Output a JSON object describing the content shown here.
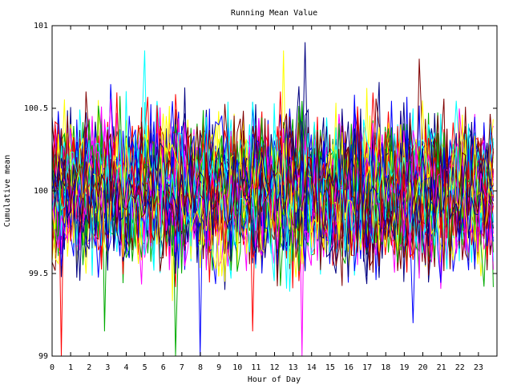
{
  "chart_data": {
    "type": "line",
    "title": "Running Mean Value",
    "xlabel": "Hour of Day",
    "ylabel": "Cumulative mean",
    "xlim": [
      0,
      24
    ],
    "ylim": [
      99,
      101
    ],
    "x_ticks": [
      0,
      1,
      2,
      3,
      4,
      5,
      6,
      7,
      8,
      9,
      10,
      11,
      12,
      13,
      14,
      15,
      16,
      17,
      18,
      19,
      20,
      21,
      22,
      23
    ],
    "x_tick_labels": [
      "0",
      "1",
      "2",
      "3",
      "4",
      "5",
      "6",
      "7",
      "8",
      "9",
      "10",
      "11",
      "12",
      "13",
      "14",
      "15",
      "16",
      "17",
      "18",
      "19",
      "20",
      "21",
      "22",
      "23"
    ],
    "y_ticks": [
      99,
      99.5,
      100,
      100.5,
      101
    ],
    "y_tick_labels": [
      "99",
      "99.5",
      "100",
      "100.5",
      "101"
    ],
    "grid": false,
    "series_colors": [
      "#ff0000",
      "#00aa00",
      "#0000ff",
      "#ff00ff",
      "#00ffff",
      "#ffff00",
      "#000080",
      "#800000"
    ],
    "series_count": 48,
    "points_per_series": 144,
    "series_mean": 100,
    "series_spread": 0.22,
    "notable_spikes": [
      {
        "x": 0.5,
        "y": 99.0
      },
      {
        "x": 6.7,
        "y": 99.0
      },
      {
        "x": 8.0,
        "y": 99.0
      },
      {
        "x": 13.5,
        "y": 99.0
      },
      {
        "x": 5.0,
        "y": 100.85
      },
      {
        "x": 12.5,
        "y": 100.85
      },
      {
        "x": 13.7,
        "y": 100.9
      },
      {
        "x": 19.8,
        "y": 100.8
      },
      {
        "x": 10.8,
        "y": 99.15
      },
      {
        "x": 2.8,
        "y": 99.15
      },
      {
        "x": 19.5,
        "y": 99.2
      }
    ]
  }
}
